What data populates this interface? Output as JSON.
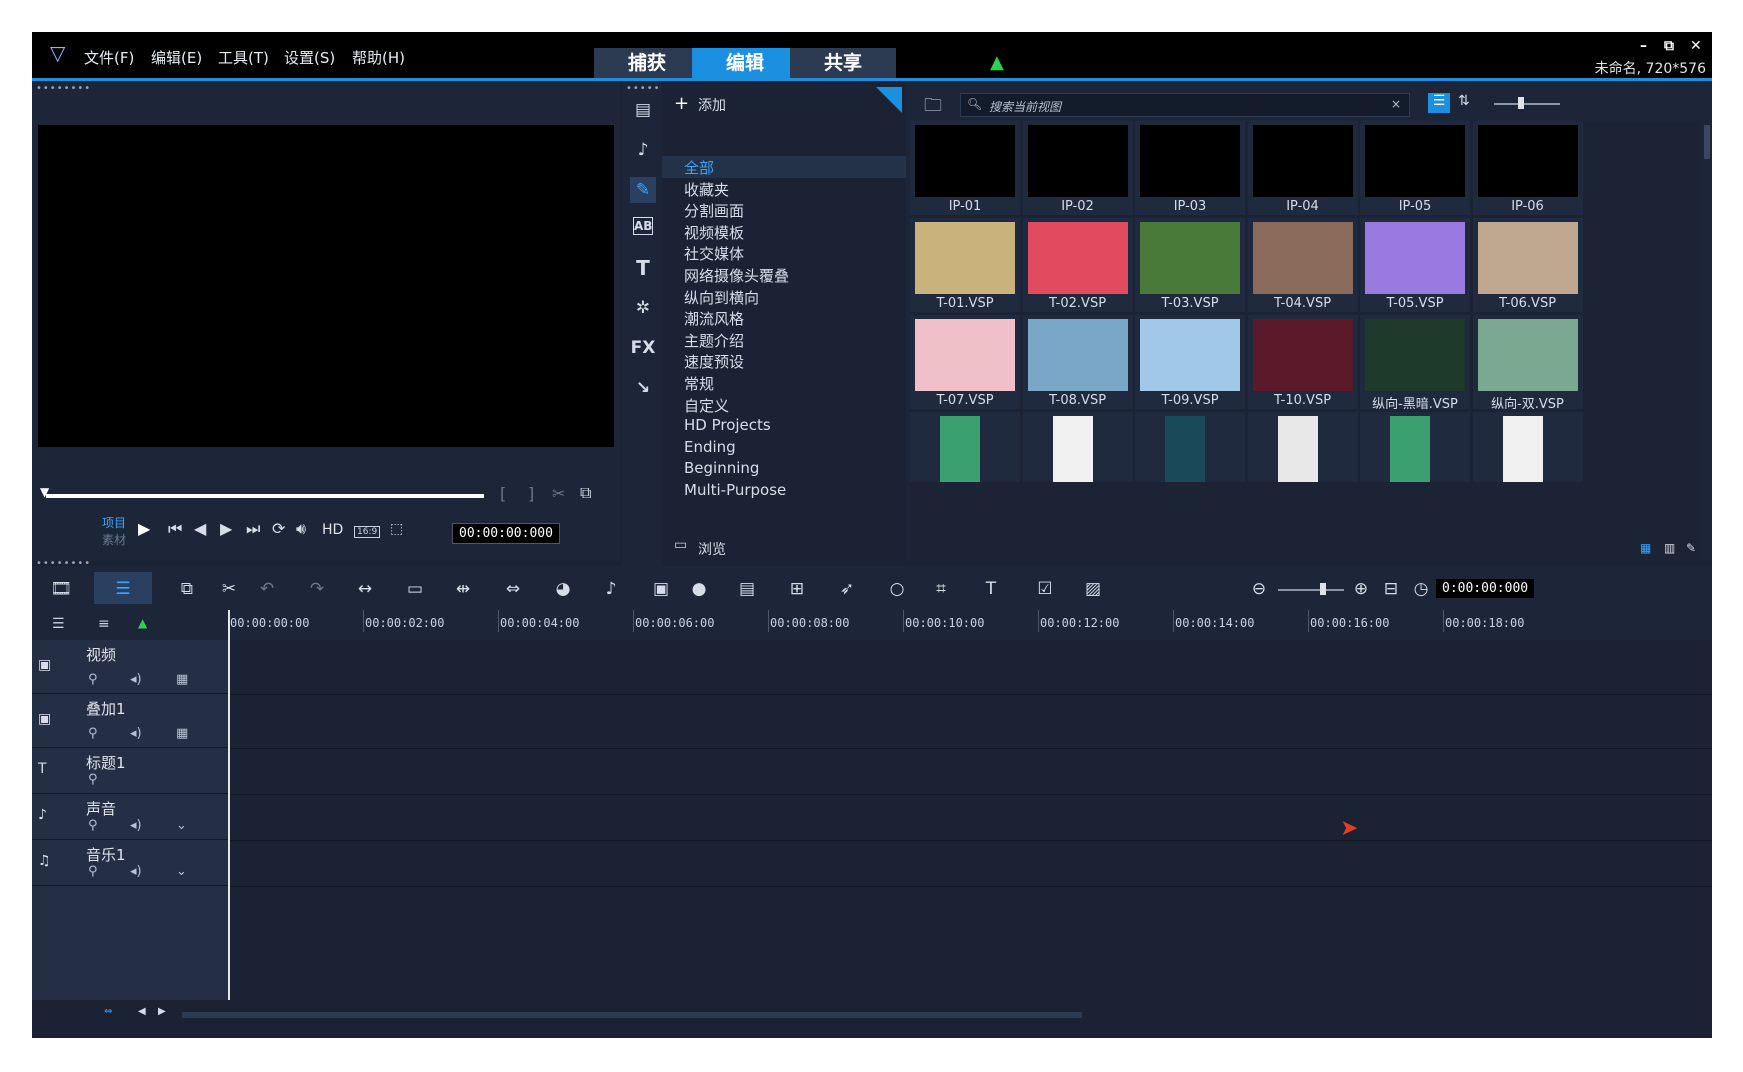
{
  "app": {
    "menus": [
      "文件(F)",
      "编辑(E)",
      "工具(T)",
      "设置(S)",
      "帮助(H)"
    ],
    "tabs": [
      "捕获",
      "编辑",
      "共享"
    ],
    "active_tab": "编辑",
    "project_info": "未命名, 720*576",
    "window_buttons": [
      "–",
      "⧉",
      "✕"
    ]
  },
  "preview": {
    "mode_project": "项目",
    "mode_clip": "素材",
    "hd_label": "HD",
    "aspect": "16:9",
    "timecode": "00:00:00:000"
  },
  "library": {
    "add_label": "添加",
    "browse_label": "浏览",
    "search_placeholder": "搜索当前视图",
    "categories": [
      "全部",
      "收藏夹",
      "分割画面",
      "视频模板",
      "社交媒体",
      "网络摄像头覆叠",
      "纵向到横向",
      "潮流风格",
      "主题介绍",
      "速度预设",
      "常规",
      "自定义",
      "HD Projects",
      "Ending",
      "Beginning",
      "Multi-Purpose"
    ],
    "active_category": "全部",
    "thumbnails": [
      [
        "IP-01",
        "IP-02",
        "IP-03",
        "IP-04",
        "IP-05",
        "IP-06"
      ],
      [
        "T-01.VSP",
        "T-02.VSP",
        "T-03.VSP",
        "T-04.VSP",
        "T-05.VSP",
        "T-06.VSP"
      ],
      [
        "T-07.VSP",
        "T-08.VSP",
        "T-09.VSP",
        "T-10.VSP",
        "纵向-黑暗.VSP",
        "纵向-双.VSP"
      ],
      [
        "",
        "",
        "",
        "",
        "",
        ""
      ]
    ],
    "side_icons": [
      "AB",
      "T",
      "FX"
    ]
  },
  "timeline": {
    "timecode": "0:00:00:000",
    "ruler": [
      "00:00:00:00",
      "00:00:02:00",
      "00:00:04:00",
      "00:00:06:00",
      "00:00:08:00",
      "00:00:10:00",
      "00:00:12:00",
      "00:00:14:00",
      "00:00:16:00",
      "00:00:18:00"
    ],
    "tracks": [
      {
        "name": "视频"
      },
      {
        "name": "叠加1"
      },
      {
        "name": "标题1"
      },
      {
        "name": "声音"
      },
      {
        "name": "音乐1"
      }
    ]
  },
  "colors": {
    "accent": "#1b8fe0",
    "background": "#1a2234",
    "panel": "#1d2638"
  }
}
